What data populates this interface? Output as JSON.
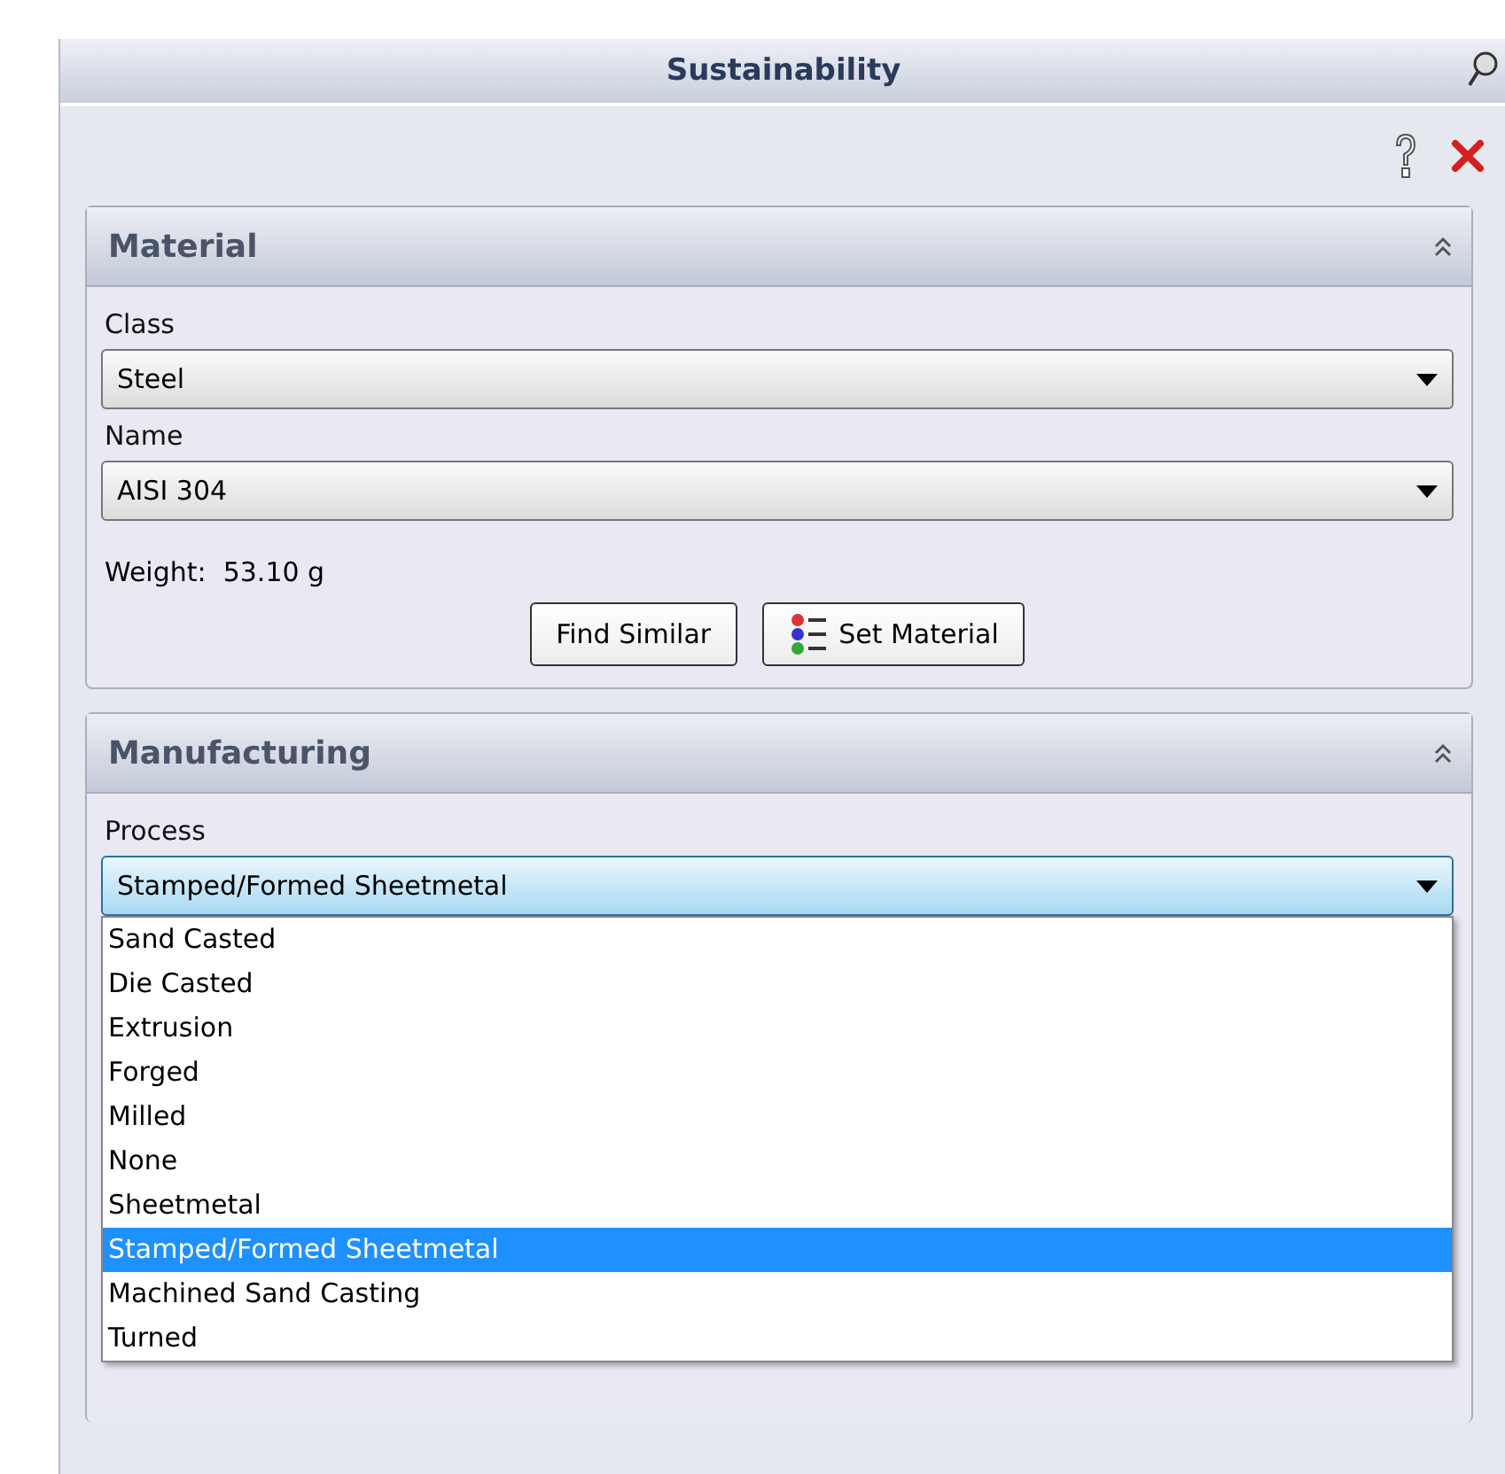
{
  "window": {
    "title": "Sustainability"
  },
  "material": {
    "title": "Material",
    "expanded": true,
    "class_label": "Class",
    "class_value": "Steel",
    "name_label": "Name",
    "name_value": "AISI 304",
    "weight": "Weight:  53.10 g",
    "buttons": [
      "Find Similar",
      "Set Material"
    ]
  },
  "manufacturing": {
    "title": "Manufacturing",
    "expanded": true,
    "process_label": "Process",
    "process_value": "Stamped/Formed Sheetmetal",
    "options": [
      {
        "label": "Sand Casted",
        "selected": false
      },
      {
        "label": "Die Casted",
        "selected": false
      },
      {
        "label": "Extrusion",
        "selected": false
      },
      {
        "label": "Forged",
        "selected": false
      },
      {
        "label": "Milled",
        "selected": false
      },
      {
        "label": "None",
        "selected": false
      },
      {
        "label": "Sheetmetal",
        "selected": false
      },
      {
        "label": "Stamped/Formed Sheetmetal",
        "selected": true
      },
      {
        "label": "Machined Sand Casting",
        "selected": false
      },
      {
        "label": "Turned",
        "selected": false
      }
    ]
  }
}
